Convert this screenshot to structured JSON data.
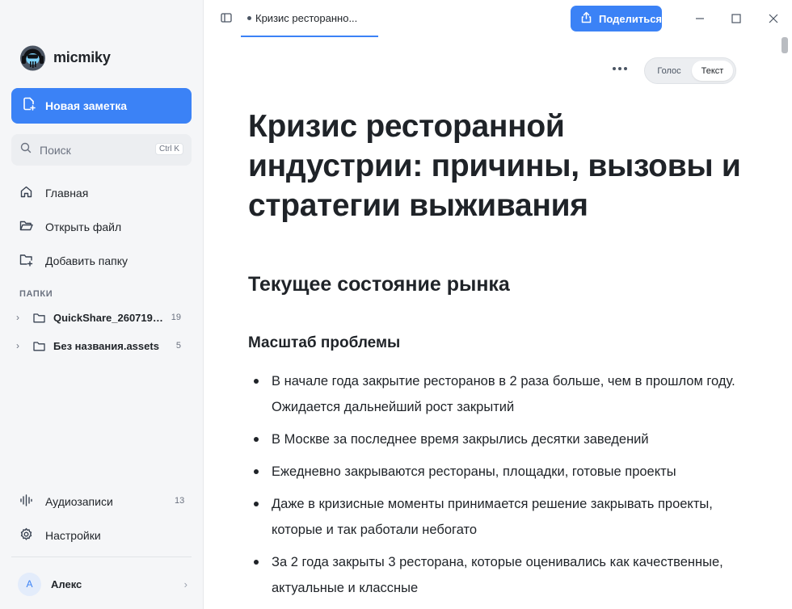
{
  "app": {
    "name": "micmiky"
  },
  "sidebar": {
    "new_note_label": "Новая заметка",
    "search": {
      "placeholder": "Поиск",
      "shortcut": "Ctrl K"
    },
    "nav": [
      {
        "label": "Главная",
        "icon": "home-icon"
      },
      {
        "label": "Открыть файл",
        "icon": "folder-open-icon"
      },
      {
        "label": "Добавить папку",
        "icon": "folder-plus-icon"
      }
    ],
    "folders_title": "ПАПКИ",
    "folders": [
      {
        "name": "QuickShare_2607191...",
        "count": "19"
      },
      {
        "name": "Без названия.assets",
        "count": "5"
      }
    ],
    "bottom": [
      {
        "label": "Аудиозаписи",
        "count": "13",
        "icon": "audio-waveform-icon"
      },
      {
        "label": "Настройки",
        "icon": "settings-gear-icon"
      }
    ],
    "user": {
      "initial": "А",
      "name": "Алекс"
    }
  },
  "topbar": {
    "tab_title": "Кризис ресторанно...",
    "share_label": "Поделиться"
  },
  "view_toggle": {
    "voice": "Голос",
    "text": "Текст",
    "selected": "Текст"
  },
  "document": {
    "title": "Кризис ресторанной индустрии: причины, вызовы и стратегии выживания",
    "h2": "Текущее состояние рынка",
    "h3": "Масштаб проблемы",
    "bullets": [
      "В начале года закрытие ресторанов в 2 раза больше, чем в прошлом году. Ожидается дальнейший рост закрытий",
      "В Москве за последнее время закрылись десятки заведений",
      "Ежедневно закрываются рестораны, площадки, готовые проекты",
      "Даже в кризисные моменты принимается решение закрывать проекты, которые и так работали небогато",
      "За 2 года закрыты 3 ресторана, которые оценивались как качественные, актуальные и классные"
    ]
  },
  "colors": {
    "accent": "#3b82f6",
    "sidebar_bg": "#f5f6f8",
    "text": "#1f2328"
  }
}
